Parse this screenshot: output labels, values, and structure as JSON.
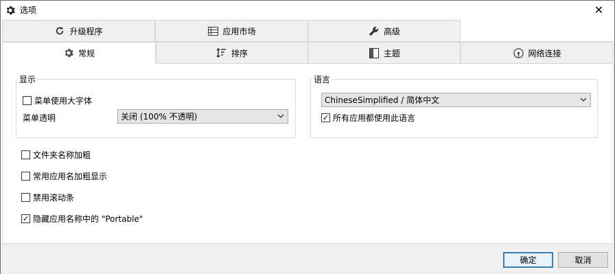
{
  "window": {
    "title": "选项",
    "close": "✕"
  },
  "tabs_row1": [
    {
      "label": "升级程序",
      "icon": "refresh-icon"
    },
    {
      "label": "应用市场",
      "icon": "list-icon"
    },
    {
      "label": "高级",
      "icon": "wrench-icon"
    },
    {
      "label": "",
      "icon": ""
    }
  ],
  "tabs_row2": [
    {
      "label": "常规",
      "icon": "gear-icon",
      "active": true
    },
    {
      "label": "排序",
      "icon": "sort-icon"
    },
    {
      "label": "主题",
      "icon": "theme-icon"
    },
    {
      "label": "网络连接",
      "icon": "network-icon"
    }
  ],
  "display_group": {
    "title": "显示",
    "large_font": {
      "label": "菜单使用大字体",
      "checked": false
    },
    "transparency_label": "菜单透明",
    "transparency_value": "关闭 (100% 不透明)"
  },
  "language_group": {
    "title": "语言",
    "language_value": "ChineseSimplified / 简体中文",
    "all_apps": {
      "label": "所有应用都使用此语言",
      "checked": true
    }
  },
  "options": [
    {
      "label": "文件夹名称加粗",
      "checked": false
    },
    {
      "label": "常用应用名加粗显示",
      "checked": false
    },
    {
      "label": "禁用滚动条",
      "checked": false
    },
    {
      "label": "隐藏应用名称中的 \"Portable\"",
      "checked": true
    }
  ],
  "buttons": {
    "ok": "确定",
    "cancel": "取消"
  },
  "colors": {
    "tab_inactive": "#f0f0f0",
    "border": "#d9d9d9",
    "primary_border": "#3c7fb1"
  }
}
